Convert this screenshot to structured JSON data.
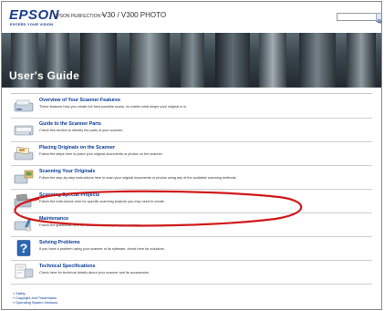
{
  "header": {
    "logo_word": "EPSON",
    "logo_tagline": "EXCEED YOUR VISION",
    "product_prefix": "EPSON PERFECTION™",
    "product_models": "V30 / V300 PHOTO",
    "search_placeholder": ""
  },
  "banner": {
    "title": "User's Guide"
  },
  "items": [
    {
      "title": "Overview of Your Scanner Features",
      "desc": "These features help you create the best possible scans, no matter what shape your original is in.",
      "icon": "scanner-features-icon"
    },
    {
      "title": "Guide to the Scanner Parts",
      "desc": "Check this section to identify the parts of your scanner.",
      "icon": "scanner-parts-icon"
    },
    {
      "title": "Placing Originals on the Scanner",
      "desc": "Follow the steps here to place your original documents or photos on the scanner.",
      "icon": "placing-originals-icon"
    },
    {
      "title": "Scanning Your Originals",
      "desc": "Follow the step-by-step instructions here to scan your original documents or photos using any of the available scanning methods.",
      "icon": "scanning-originals-icon"
    },
    {
      "title": "Scanning Special Projects",
      "desc": "Follow the instructions here for specific scanning projects you may need to create.",
      "icon": "special-projects-icon"
    },
    {
      "title": "Maintenance",
      "desc": "Follow the guidelines here to maintain and transport your scanner.",
      "icon": "maintenance-icon"
    },
    {
      "title": "Solving Problems",
      "desc": "If you have a problem using your scanner or its software, check here for solutions.",
      "icon": "question-mark-icon"
    },
    {
      "title": "Technical Specifications",
      "desc": "Check here for technical details about your scanner and its accessories.",
      "icon": "technical-specifications-icon"
    }
  ],
  "footer": {
    "links": [
      "Safety",
      "Copyright and Trademarks",
      "Operating System Versions"
    ]
  },
  "colors": {
    "link": "#0a3a96",
    "logo": "#1b3e8c",
    "highlight_ellipse": "#d11a1a"
  }
}
